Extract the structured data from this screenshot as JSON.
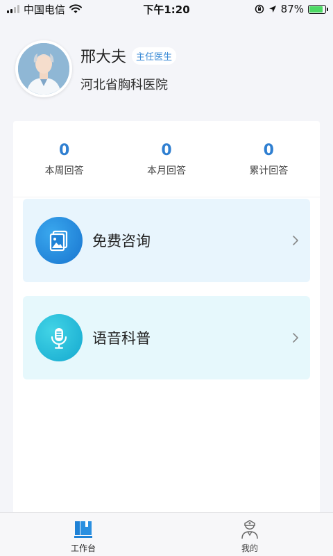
{
  "status_bar": {
    "carrier": "中国电信",
    "time": "下午1:20",
    "battery_percent": "87%",
    "battery_level": 0.87,
    "icons": [
      "signal-icon",
      "wifi-icon",
      "orientation-lock-icon",
      "location-icon",
      "battery-icon"
    ]
  },
  "profile": {
    "name": "邢大夫",
    "title": "主任医生",
    "hospital": "河北省胸科医院"
  },
  "stats": [
    {
      "value": "0",
      "label": "本周回答"
    },
    {
      "value": "0",
      "label": "本月回答"
    },
    {
      "value": "0",
      "label": "累计回答"
    }
  ],
  "actions": {
    "consult": {
      "label": "免费咨询",
      "icon": "gallery-icon"
    },
    "voice": {
      "label": "语音科普",
      "icon": "microphone-icon"
    }
  },
  "tabs": [
    {
      "label": "工作台",
      "icon": "workbench-icon",
      "active": true
    },
    {
      "label": "我的",
      "icon": "doctor-icon",
      "active": false
    }
  ],
  "colors": {
    "accent": "#2f7fd1",
    "page_bg": "#f4f5f9",
    "consult_bg": "#e8f5fd",
    "voice_bg": "#e6f8fc"
  }
}
